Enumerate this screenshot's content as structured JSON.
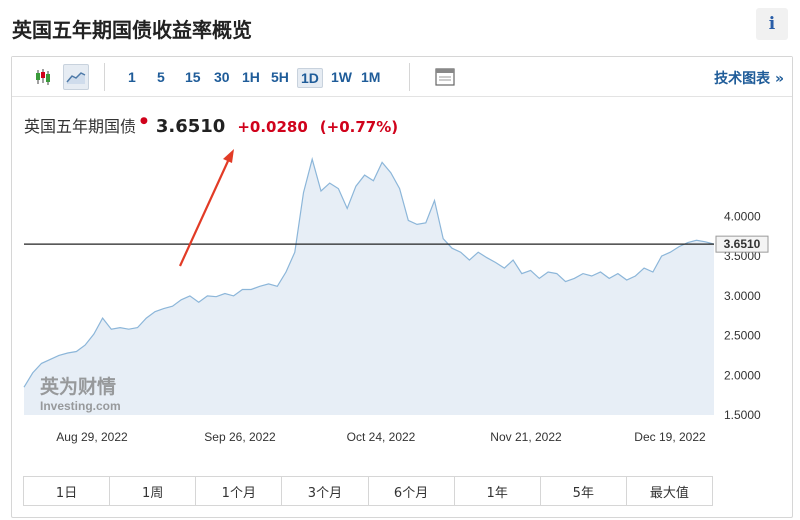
{
  "page": {
    "title": "英国五年期国债收益率概览",
    "info_icon": "i"
  },
  "toolbar": {
    "chart_types": [
      {
        "icon": "candlestick-icon"
      },
      {
        "icon": "area-chart-icon",
        "selected": true
      }
    ],
    "intervals": [
      "1",
      "5",
      "15",
      "30",
      "1H",
      "5H",
      "1D",
      "1W",
      "1M"
    ],
    "active_interval": "1D",
    "settings_icon": "window-icon",
    "tech_chart": "技术图表 »"
  },
  "quote": {
    "name": "英国五年期国债",
    "last": "3.6510",
    "change": "+0.0280",
    "change_pct": "(+0.77%)"
  },
  "watermark": {
    "line1": "英为财情",
    "line2": "Investing.com"
  },
  "ranges": [
    "1日",
    "1周",
    "1个月",
    "3个月",
    "6个月",
    "1年",
    "5年",
    "最大值"
  ],
  "colors": {
    "line": "#8cb6d9",
    "fill": "#e7eef6",
    "up": "#d0021b",
    "last_line": "#222222",
    "arrow": "#e23b26"
  },
  "chart_data": {
    "type": "area",
    "title": "",
    "xlabel": "",
    "ylabel": "",
    "x_ticks": [
      "Aug 29, 2022",
      "Sep 26, 2022",
      "Oct 24, 2022",
      "Nov 21, 2022",
      "Dec 19, 2022"
    ],
    "y_ticks": [
      "1.5000",
      "2.0000",
      "2.5000",
      "3.0000",
      "3.5000",
      "4.0000"
    ],
    "ylim": [
      1.5,
      5.0
    ],
    "last_value": 3.651,
    "last_label": "3.6510",
    "values": [
      1.85,
      2.03,
      2.15,
      2.2,
      2.25,
      2.28,
      2.3,
      2.38,
      2.52,
      2.72,
      2.58,
      2.6,
      2.58,
      2.6,
      2.72,
      2.8,
      2.84,
      2.87,
      2.95,
      3.0,
      2.92,
      3.0,
      2.99,
      3.03,
      3.0,
      3.08,
      3.08,
      3.12,
      3.15,
      3.12,
      3.3,
      3.55,
      4.3,
      4.72,
      4.32,
      4.42,
      4.35,
      4.1,
      4.38,
      4.52,
      4.45,
      4.68,
      4.55,
      4.35,
      3.95,
      3.9,
      3.92,
      4.2,
      3.72,
      3.6,
      3.55,
      3.45,
      3.55,
      3.48,
      3.42,
      3.35,
      3.45,
      3.28,
      3.32,
      3.22,
      3.3,
      3.28,
      3.18,
      3.22,
      3.28,
      3.25,
      3.3,
      3.22,
      3.28,
      3.2,
      3.25,
      3.35,
      3.3,
      3.5,
      3.55,
      3.62,
      3.67,
      3.7,
      3.68,
      3.651
    ]
  }
}
